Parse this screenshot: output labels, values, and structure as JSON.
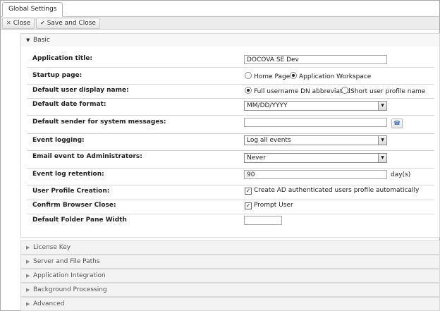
{
  "tab": {
    "label": "Global Settings"
  },
  "toolbar": {
    "close_label": "Close",
    "save_close_label": "Save and Close"
  },
  "sections": {
    "basic": "Basic",
    "license_key": "License Key",
    "server_paths": "Server and File Paths",
    "app_integration": "Application Integration",
    "background": "Background Processing",
    "advanced": "Advanced"
  },
  "form": {
    "app_title": {
      "label": "Application title:",
      "value": "DOCOVA SE Dev"
    },
    "startup_page": {
      "label": "Startup page:",
      "options": [
        "Home Page",
        "Application Workspace"
      ],
      "selected": "Application Workspace"
    },
    "user_display": {
      "label": "Default user display name:",
      "options": [
        "Full username DN abbreviated",
        "Short user profile name"
      ],
      "selected": "Full username DN abbreviated"
    },
    "date_format": {
      "label": "Default date format:",
      "value": "MM/DD/YYYY"
    },
    "sender": {
      "label": "Default sender for system messages:",
      "value": ""
    },
    "event_logging": {
      "label": "Event logging:",
      "value": "Log all events"
    },
    "email_admins": {
      "label": "Email event to Administrators:",
      "value": "Never"
    },
    "log_retention": {
      "label": "Event log retention:",
      "value": "90",
      "unit": "day(s)"
    },
    "profile_creation": {
      "label": "User Profile Creation:",
      "option": "Create AD authenticated users profile automatically",
      "checked": true
    },
    "browser_close": {
      "label": "Confirm Browser Close:",
      "option": "Prompt User",
      "checked": true
    },
    "folder_width": {
      "label": "Default Folder Pane Width",
      "value": ""
    }
  },
  "icons": {
    "close": "close-icon",
    "save": "checkmark-icon",
    "expand": "triangle-right-icon",
    "collapse": "triangle-down-icon",
    "lookup": "address-book-icon",
    "dropdown": "chevron-down-icon"
  }
}
